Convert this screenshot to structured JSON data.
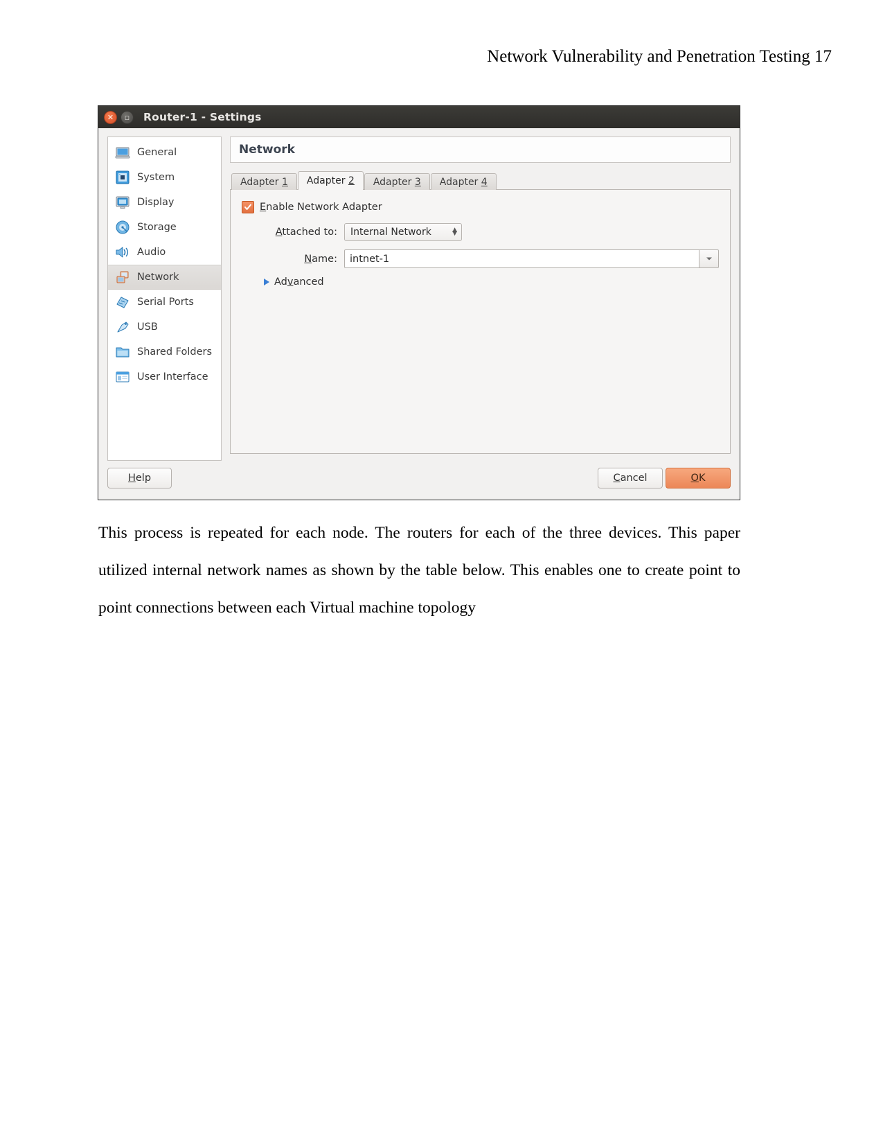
{
  "document": {
    "running_head": "Network Vulnerability and Penetration Testing 17",
    "paragraph": "This process is repeated for each node. The routers for each of the three devices. This paper utilized internal network names as shown by the table below. This enables one to create point to point connections between each Virtual machine topology"
  },
  "dialog": {
    "title": "Router-1 - Settings",
    "titlebar": {
      "close_icon": "close-icon",
      "maximize_icon": "maximize-icon"
    },
    "sidebar": {
      "items": [
        {
          "label": "General",
          "icon": "monitor-icon",
          "selected": false
        },
        {
          "label": "System",
          "icon": "chip-icon",
          "selected": false
        },
        {
          "label": "Display",
          "icon": "display-icon",
          "selected": false
        },
        {
          "label": "Storage",
          "icon": "disk-icon",
          "selected": false
        },
        {
          "label": "Audio",
          "icon": "speaker-icon",
          "selected": false
        },
        {
          "label": "Network",
          "icon": "network-icon",
          "selected": true
        },
        {
          "label": "Serial Ports",
          "icon": "serial-port-icon",
          "selected": false
        },
        {
          "label": "USB",
          "icon": "usb-icon",
          "selected": false
        },
        {
          "label": "Shared Folders",
          "icon": "folder-icon",
          "selected": false
        },
        {
          "label": "User Interface",
          "icon": "user-interface-icon",
          "selected": false
        }
      ]
    },
    "pane": {
      "heading": "Network",
      "tabs": [
        {
          "label": "Adapter 1",
          "mnemonic": "1",
          "active": false
        },
        {
          "label": "Adapter 2",
          "mnemonic": "2",
          "active": true
        },
        {
          "label": "Adapter 3",
          "mnemonic": "3",
          "active": false
        },
        {
          "label": "Adapter 4",
          "mnemonic": "4",
          "active": false
        }
      ],
      "enable_adapter": {
        "label": "Enable Network Adapter",
        "checked": true
      },
      "attached_to": {
        "label": "Attached to:",
        "value": "Internal Network"
      },
      "name": {
        "label": "Name:",
        "value": "intnet-1"
      },
      "advanced": {
        "label": "Advanced",
        "expanded": false
      }
    },
    "buttons": {
      "help": "Help",
      "cancel": "Cancel",
      "ok": "OK"
    },
    "colors": {
      "accent": "#ec8758",
      "titlebar": "#2e2d2a",
      "selection": "#dedbd8"
    }
  }
}
